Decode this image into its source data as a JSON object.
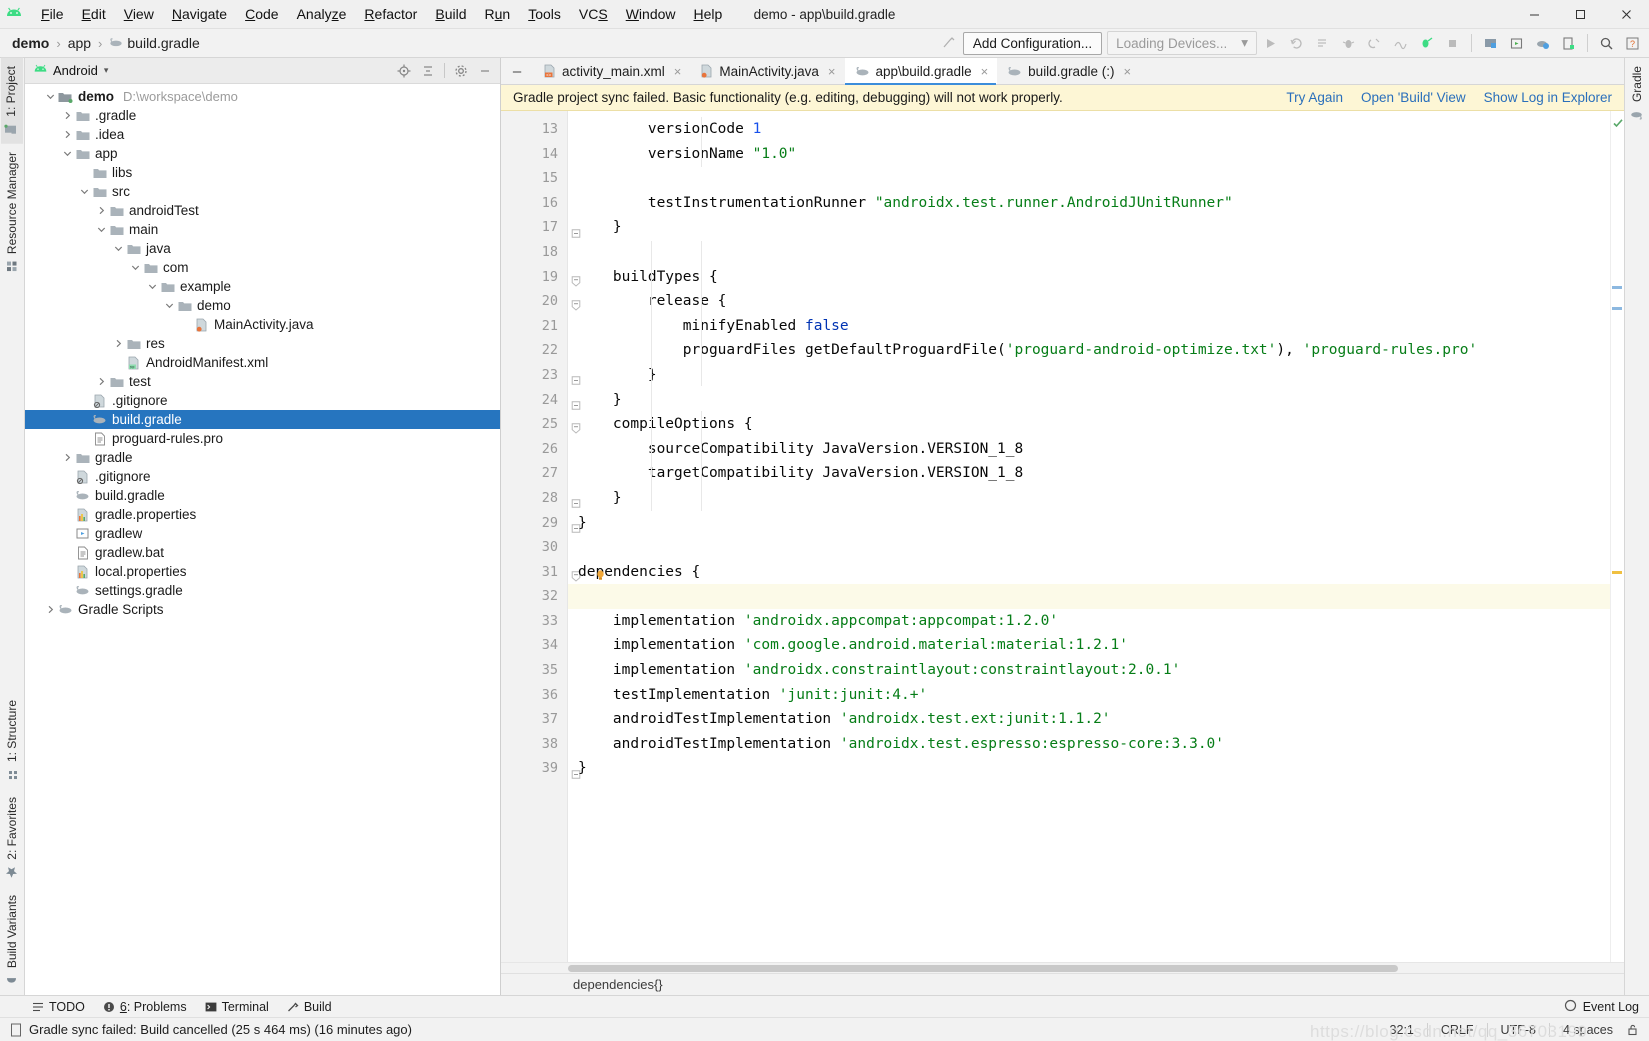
{
  "window": {
    "title": "demo - app\\build.gradle",
    "minimize": "–",
    "maximize": "☐",
    "close": "×"
  },
  "menu": [
    {
      "label": "File",
      "mnemonic": "F"
    },
    {
      "label": "Edit",
      "mnemonic": "E"
    },
    {
      "label": "View",
      "mnemonic": "V"
    },
    {
      "label": "Navigate",
      "mnemonic": "N"
    },
    {
      "label": "Code",
      "mnemonic": "C"
    },
    {
      "label": "Analyze",
      "mnemonic": "z"
    },
    {
      "label": "Refactor",
      "mnemonic": "R"
    },
    {
      "label": "Build",
      "mnemonic": "B"
    },
    {
      "label": "Run",
      "mnemonic": "u"
    },
    {
      "label": "Tools",
      "mnemonic": "T"
    },
    {
      "label": "VCS",
      "mnemonic": "S"
    },
    {
      "label": "Window",
      "mnemonic": "W"
    },
    {
      "label": "Help",
      "mnemonic": "H"
    }
  ],
  "breadcrumb": [
    {
      "label": "demo",
      "bold": true
    },
    {
      "label": "app",
      "bold": false
    },
    {
      "label": "build.gradle",
      "bold": false,
      "icon": "gradle-icon"
    }
  ],
  "toolbar": {
    "add_configuration": "Add Configuration...",
    "devices": "Loading Devices...",
    "devices_caret": "▾",
    "icons": [
      "run-icon",
      "rerun-icon",
      "run-tests-icon",
      "debug-icon",
      "attach-debugger-icon",
      "profile-icon",
      "apply-changes-icon",
      "stop-icon",
      "avd-manager-icon",
      "sdk-manager-icon",
      "sync-gradle-icon",
      "layout-inspector-icon",
      "search-icon",
      "help-icon"
    ]
  },
  "sidebar_left_tabs": [
    {
      "label": "1: Project",
      "icon": "project-icon",
      "active": true
    },
    {
      "label": "Resource Manager",
      "icon": "resource-icon",
      "active": false
    }
  ],
  "sidebar_left_bottom_tabs": [
    {
      "label": "1: Structure",
      "icon": "structure-icon"
    },
    {
      "label": "2: Favorites",
      "icon": "star-icon"
    },
    {
      "label": "Build Variants",
      "icon": "variants-icon"
    }
  ],
  "sidebar_right_tabs": [
    {
      "label": "Gradle",
      "icon": "gradle-icon"
    }
  ],
  "project": {
    "view_title": "Android",
    "view_caret": "▾",
    "header_icons": [
      "locate-icon",
      "collapse-all-icon",
      "settings-icon",
      "hide-icon"
    ],
    "tree": [
      {
        "depth": 0,
        "arrow": "down",
        "icon": "module-icon",
        "label": "demo",
        "bold": true,
        "path": "D:\\workspace\\demo"
      },
      {
        "depth": 1,
        "arrow": "right",
        "icon": "folder-icon",
        "label": ".gradle"
      },
      {
        "depth": 1,
        "arrow": "right",
        "icon": "folder-icon",
        "label": ".idea"
      },
      {
        "depth": 1,
        "arrow": "down",
        "icon": "folder-icon",
        "label": "app"
      },
      {
        "depth": 2,
        "arrow": "none",
        "icon": "folder-icon",
        "label": "libs"
      },
      {
        "depth": 2,
        "arrow": "down",
        "icon": "folder-icon",
        "label": "src"
      },
      {
        "depth": 3,
        "arrow": "right",
        "icon": "folder-icon",
        "label": "androidTest"
      },
      {
        "depth": 3,
        "arrow": "down",
        "icon": "folder-icon",
        "label": "main"
      },
      {
        "depth": 4,
        "arrow": "down",
        "icon": "folder-icon",
        "label": "java"
      },
      {
        "depth": 5,
        "arrow": "down",
        "icon": "folder-icon",
        "label": "com"
      },
      {
        "depth": 6,
        "arrow": "down",
        "icon": "folder-icon",
        "label": "example"
      },
      {
        "depth": 7,
        "arrow": "down",
        "icon": "folder-icon",
        "label": "demo"
      },
      {
        "depth": 8,
        "arrow": "none",
        "icon": "java-file-icon",
        "label": "MainActivity.java"
      },
      {
        "depth": 4,
        "arrow": "right",
        "icon": "folder-icon",
        "label": "res"
      },
      {
        "depth": 4,
        "arrow": "none",
        "icon": "manifest-icon",
        "label": "AndroidManifest.xml"
      },
      {
        "depth": 3,
        "arrow": "right",
        "icon": "folder-icon",
        "label": "test"
      },
      {
        "depth": 2,
        "arrow": "none",
        "icon": "gitignore-icon",
        "label": ".gitignore"
      },
      {
        "depth": 2,
        "arrow": "none",
        "icon": "gradle-icon",
        "label": "build.gradle",
        "selected": true
      },
      {
        "depth": 2,
        "arrow": "none",
        "icon": "text-file-icon",
        "label": "proguard-rules.pro"
      },
      {
        "depth": 1,
        "arrow": "right",
        "icon": "folder-icon",
        "label": "gradle"
      },
      {
        "depth": 1,
        "arrow": "none",
        "icon": "gitignore-icon",
        "label": ".gitignore"
      },
      {
        "depth": 1,
        "arrow": "none",
        "icon": "gradle-icon",
        "label": "build.gradle"
      },
      {
        "depth": 1,
        "arrow": "none",
        "icon": "properties-icon",
        "label": "gradle.properties"
      },
      {
        "depth": 1,
        "arrow": "none",
        "icon": "script-icon",
        "label": "gradlew"
      },
      {
        "depth": 1,
        "arrow": "none",
        "icon": "text-file-icon",
        "label": "gradlew.bat"
      },
      {
        "depth": 1,
        "arrow": "none",
        "icon": "properties-icon",
        "label": "local.properties"
      },
      {
        "depth": 1,
        "arrow": "none",
        "icon": "gradle-icon",
        "label": "settings.gradle"
      },
      {
        "depth": 0,
        "arrow": "right",
        "icon": "gradle-icon",
        "label": "Gradle Scripts"
      }
    ]
  },
  "editor": {
    "collapse_icon": "–",
    "tabs": [
      {
        "label": "activity_main.xml",
        "icon": "xml-layout-icon",
        "active": false,
        "close": "×"
      },
      {
        "label": "MainActivity.java",
        "icon": "java-file-icon",
        "active": false,
        "close": "×"
      },
      {
        "label": "app\\build.gradle",
        "icon": "gradle-icon",
        "active": true,
        "close": "×"
      },
      {
        "label": "build.gradle (:)",
        "icon": "gradle-icon",
        "active": false,
        "close": "×"
      }
    ],
    "banner": {
      "message": "Gradle project sync failed. Basic functionality (e.g. editing, debugging) will not work properly.",
      "links": [
        "Try Again",
        "Open 'Build' View",
        "Show Log in Explorer"
      ]
    },
    "first_line_number": 13,
    "lines": [
      {
        "n": 13,
        "fold": "",
        "tokens": [
          {
            "t": "        versionCode ",
            "c": "pl"
          },
          {
            "t": "1",
            "c": "n"
          }
        ]
      },
      {
        "n": 14,
        "fold": "",
        "tokens": [
          {
            "t": "        versionName ",
            "c": "pl"
          },
          {
            "t": "\"1.0\"",
            "c": "s"
          }
        ]
      },
      {
        "n": 15,
        "fold": "",
        "tokens": []
      },
      {
        "n": 16,
        "fold": "",
        "tokens": [
          {
            "t": "        testInstrumentationRunner ",
            "c": "pl"
          },
          {
            "t": "\"androidx.test.runner.AndroidJUnitRunner\"",
            "c": "s"
          }
        ]
      },
      {
        "n": 17,
        "fold": "end",
        "tokens": [
          {
            "t": "    }",
            "c": "pl"
          }
        ]
      },
      {
        "n": 18,
        "fold": "",
        "tokens": []
      },
      {
        "n": 19,
        "fold": "start",
        "tokens": [
          {
            "t": "    buildTypes {",
            "c": "pl"
          }
        ]
      },
      {
        "n": 20,
        "fold": "start",
        "tokens": [
          {
            "t": "        release {",
            "c": "pl"
          }
        ]
      },
      {
        "n": 21,
        "fold": "",
        "tokens": [
          {
            "t": "            minifyEnabled ",
            "c": "pl"
          },
          {
            "t": "false",
            "c": "k"
          }
        ]
      },
      {
        "n": 22,
        "fold": "",
        "tokens": [
          {
            "t": "            proguardFiles getDefaultProguardFile(",
            "c": "pl"
          },
          {
            "t": "'proguard-android-optimize.txt'",
            "c": "s"
          },
          {
            "t": "), ",
            "c": "pl"
          },
          {
            "t": "'proguard-rules.pro'",
            "c": "s"
          }
        ]
      },
      {
        "n": 23,
        "fold": "end",
        "tokens": [
          {
            "t": "        }",
            "c": "pl"
          }
        ]
      },
      {
        "n": 24,
        "fold": "end",
        "tokens": [
          {
            "t": "    }",
            "c": "pl"
          }
        ]
      },
      {
        "n": 25,
        "fold": "start",
        "tokens": [
          {
            "t": "    compileOptions {",
            "c": "pl"
          }
        ]
      },
      {
        "n": 26,
        "fold": "",
        "tokens": [
          {
            "t": "        sourceCompatibility JavaVersion.VERSION_1_8",
            "c": "pl"
          }
        ]
      },
      {
        "n": 27,
        "fold": "",
        "tokens": [
          {
            "t": "        targetCompatibility JavaVersion.VERSION_1_8",
            "c": "pl"
          }
        ]
      },
      {
        "n": 28,
        "fold": "end",
        "tokens": [
          {
            "t": "    }",
            "c": "pl"
          }
        ]
      },
      {
        "n": 29,
        "fold": "end",
        "tokens": [
          {
            "t": "}",
            "c": "pl"
          }
        ]
      },
      {
        "n": 30,
        "fold": "",
        "tokens": []
      },
      {
        "n": 31,
        "fold": "start",
        "tokens": [
          {
            "t": "dependencies {",
            "c": "pl"
          }
        ]
      },
      {
        "n": 32,
        "fold": "",
        "tokens": [],
        "highlight": true
      },
      {
        "n": 33,
        "fold": "",
        "tokens": [
          {
            "t": "    implementation ",
            "c": "pl"
          },
          {
            "t": "'androidx.appcompat:appcompat:1.2.0'",
            "c": "s"
          }
        ]
      },
      {
        "n": 34,
        "fold": "",
        "tokens": [
          {
            "t": "    implementation ",
            "c": "pl"
          },
          {
            "t": "'com.google.android.material:material:1.2.1'",
            "c": "s"
          }
        ]
      },
      {
        "n": 35,
        "fold": "",
        "tokens": [
          {
            "t": "    implementation ",
            "c": "pl"
          },
          {
            "t": "'androidx.constraintlayout:constraintlayout:2.0.1'",
            "c": "s"
          }
        ]
      },
      {
        "n": 36,
        "fold": "",
        "tokens": [
          {
            "t": "    testImplementation ",
            "c": "pl"
          },
          {
            "t": "'junit:junit:4.+'",
            "c": "s"
          }
        ]
      },
      {
        "n": 37,
        "fold": "",
        "tokens": [
          {
            "t": "    androidTestImplementation ",
            "c": "pl"
          },
          {
            "t": "'androidx.test.ext:junit:1.1.2'",
            "c": "s"
          }
        ]
      },
      {
        "n": 38,
        "fold": "",
        "tokens": [
          {
            "t": "    androidTestImplementation ",
            "c": "pl"
          },
          {
            "t": "'androidx.test.espresso:espresso-core:3.3.0'",
            "c": "s"
          }
        ]
      },
      {
        "n": 39,
        "fold": "end",
        "tokens": [
          {
            "t": "}",
            "c": "pl"
          }
        ]
      }
    ],
    "breadcrumb_status": "dependencies{}"
  },
  "tool_windows": [
    {
      "label": "TODO",
      "icon": "todo-icon",
      "mnemonic": ""
    },
    {
      "label": "Problems",
      "icon": "problems-icon",
      "mnemonic": "6"
    },
    {
      "label": "Terminal",
      "icon": "terminal-icon",
      "mnemonic": ""
    },
    {
      "label": "Build",
      "icon": "build-icon",
      "mnemonic": ""
    }
  ],
  "event_log": "Event Log",
  "statusbar": {
    "icon": "document-icon",
    "message": "Gradle sync failed: Build cancelled (25 s 464 ms) (16 minutes ago)",
    "caret": "32:1",
    "line_sep": "CRLF",
    "encoding": "UTF-8",
    "indent": "4 spaces",
    "lock_icon": "unlocked-icon",
    "watermark": "https://blog.csdn.net/qq_36703199"
  },
  "colors": {
    "accent": "#2675bf",
    "banner_bg": "#fdf6d5",
    "link": "#2a6fbb",
    "string": "#067d17",
    "keyword": "#0033b3",
    "number": "#1750eb",
    "green_check": "#59a869"
  }
}
